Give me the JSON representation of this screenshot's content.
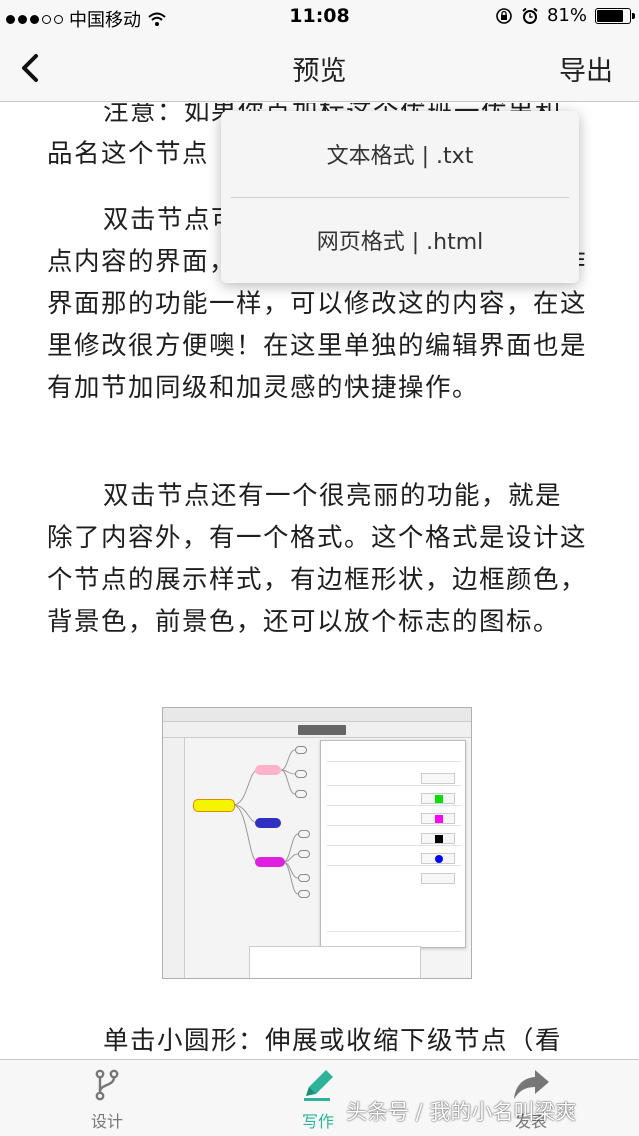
{
  "status_bar": {
    "carrier": "中国移动",
    "time": "11:08",
    "battery": "81%",
    "battery_level": 0.81
  },
  "nav": {
    "title": "预览",
    "export_label": "导出"
  },
  "content": {
    "p1": "注意：如果你点加标这个优班一优串和品名这个节点",
    "p2": "双击节点可以弹出一个单独编辑这个节点内容的界面，这时你就可以写作，跟在写作界面那的功能一样，可以修改这的内容，在这里修改很方便噢！在这里单独的编辑界面也是有加节加同级和加灵感的快捷操作。",
    "p3": "双击节点还有一个很亮丽的功能，就是除了内容外，有一个格式。这个格式是设计这个节点的展示样式，有边框形状，边框颜色，背景色，前景色，还可以放个标志的图标。",
    "p4": "单击小圆形：伸展或收缩下级节点（看"
  },
  "export_menu": {
    "items": [
      {
        "label": "文本格式 | .txt"
      },
      {
        "label": "网页格式 | .html"
      }
    ]
  },
  "tabs": [
    {
      "label": "设计",
      "icon": "branch-icon"
    },
    {
      "label": "写作",
      "icon": "pencil-icon",
      "active": true
    },
    {
      "label": "发表",
      "icon": "share-arrow-icon"
    }
  ],
  "colors": {
    "accent": "#2db39a",
    "tab_inactive": "#777777",
    "bar_background": "#f7f7f7"
  },
  "watermark": "头条号 / 我的小名叫梁爽"
}
